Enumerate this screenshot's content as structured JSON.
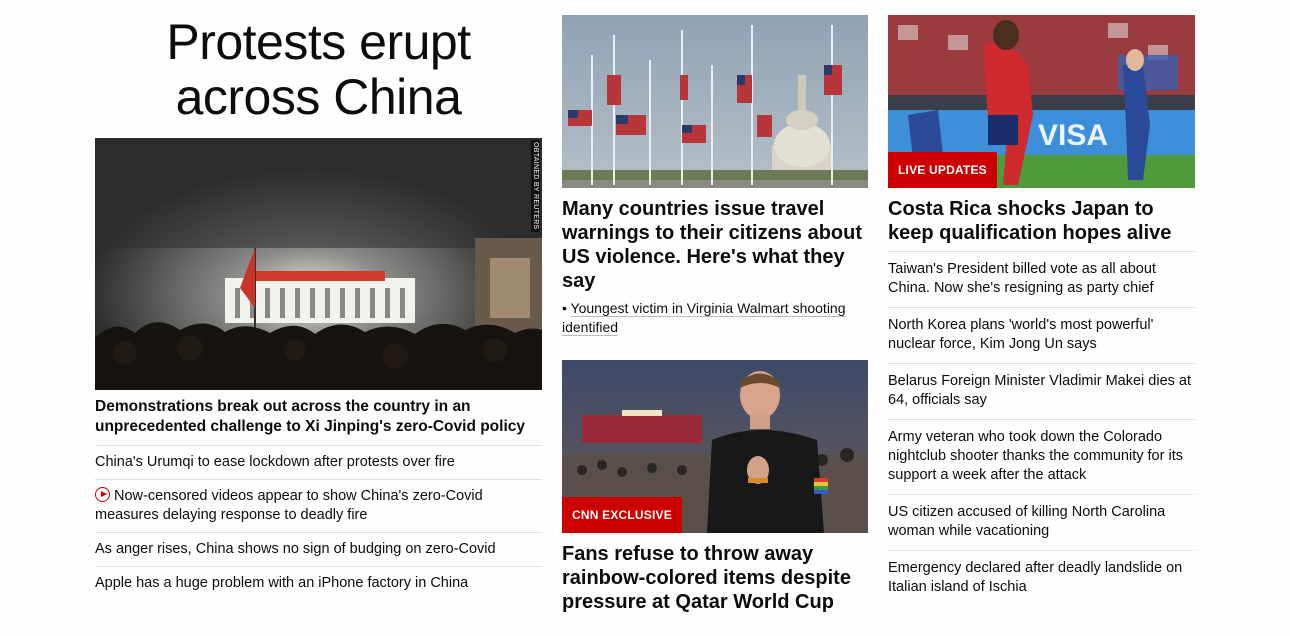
{
  "lead": {
    "headline": "Protests erupt across China",
    "image_credit": "OBTAINED BY REUTERS",
    "image_alt": "Nighttime crowd of protesters with red flags",
    "subheadline": "Demonstrations break out across the country in an unprecedented challenge to Xi Jinping's zero-Covid policy",
    "related": [
      {
        "text": "China's Urumqi to ease lockdown after protests over fire",
        "video": false
      },
      {
        "text": "Now-censored videos appear to show China's zero-Covid measures delaying response to deadly fire",
        "video": true
      },
      {
        "text": "As anger rises, China shows no sign of budging on zero-Covid",
        "video": false
      },
      {
        "text": "Apple has a huge problem with an iPhone factory in China",
        "video": false
      }
    ]
  },
  "middle": {
    "story1": {
      "image_alt": "Flags at half-staff near the US Capitol",
      "title": "Many countries issue travel warnings to their citizens about US violence. Here's what they say",
      "bullet": "Youngest victim in Virginia Walmart shooting identified"
    },
    "story2": {
      "image_alt": "Fan at World Cup stadium wearing rainbow wristband",
      "badge": "CNN EXCLUSIVE",
      "title": "Fans refuse to throw away rainbow-colored items despite pressure at Qatar World Cup"
    }
  },
  "right": {
    "story": {
      "image_alt": "Costa Rica player celebrating on pitch",
      "badge": "LIVE UPDATES",
      "title": "Costa Rica shocks Japan to keep qualification hopes alive"
    },
    "links": [
      "Taiwan's President billed vote as all about China. Now she's resigning as party chief",
      "North Korea plans 'world's most powerful' nuclear force, Kim Jong Un says",
      "Belarus Foreign Minister Vladimir Makei dies at 64, officials say",
      "Army veteran who took down the Colorado nightclub shooter thanks the community for its support a week after the attack",
      "US citizen accused of killing North Carolina woman while vacationing",
      "Emergency declared after deadly landslide on Italian island of Ischia"
    ]
  },
  "colors": {
    "text": "#0c0c0c",
    "accent_red": "#cc0000",
    "divider": "#e1e1e1",
    "background": "#fefefe"
  }
}
